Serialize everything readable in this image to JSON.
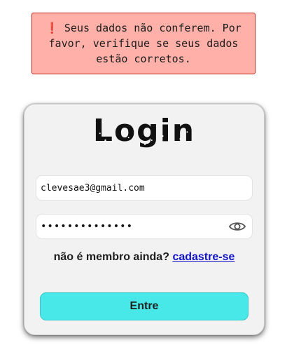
{
  "alert": {
    "icon": "exclamation-icon",
    "icon_glyph": "❗",
    "message": "Seus dados não conferem. Por favor, verifique se seus dados estão corretos.",
    "background": "#ffb0a8",
    "border": "#c3241b"
  },
  "login": {
    "title": "Login",
    "email": {
      "value": "clevesae3@gmail.com",
      "placeholder": ""
    },
    "password": {
      "value": "••••••••••••••",
      "placeholder": "",
      "toggle_icon": "eye-icon"
    },
    "signup_prompt": "não é membro ainda?",
    "signup_link": "cadastre-se",
    "submit_label": "Entre"
  },
  "colors": {
    "card_background": "#f2f2f2",
    "button_background": "#48e8e8",
    "link": "#1212c8"
  }
}
